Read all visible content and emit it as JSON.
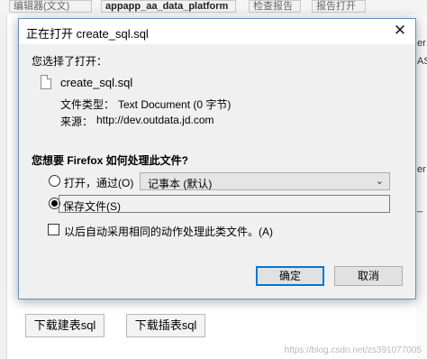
{
  "background": {
    "top_fragments": [
      "编辑器(文文)",
      "appapp_aa_data_platform",
      "检查报告",
      "报告打开"
    ],
    "right_fragments": [
      "er",
      "AS",
      "er",
      "_"
    ],
    "buttons": [
      "下载建表sql",
      "下载插表sql"
    ],
    "watermark": "https://blog.csdn.net/zs391077005"
  },
  "dialog": {
    "title": "正在打开 create_sql.sql",
    "close_glyph": "✕",
    "intro": "您选择了打开：",
    "file_name": "create_sql.sql",
    "file_type_label": "文件类型：",
    "file_type_value": "Text Document (0 字节)",
    "source_label": "来源：",
    "source_value": "http://dev.outdata.jd.com",
    "question": "您想要 Firefox 如何处理此文件?",
    "open_with_label": "打开，通过(O)",
    "open_with_app": "记事本 (默认)",
    "save_label": "保存文件(S)",
    "remember_label": "以后自动采用相同的动作处理此类文件。(A)",
    "ok": "确定",
    "cancel": "取消"
  }
}
